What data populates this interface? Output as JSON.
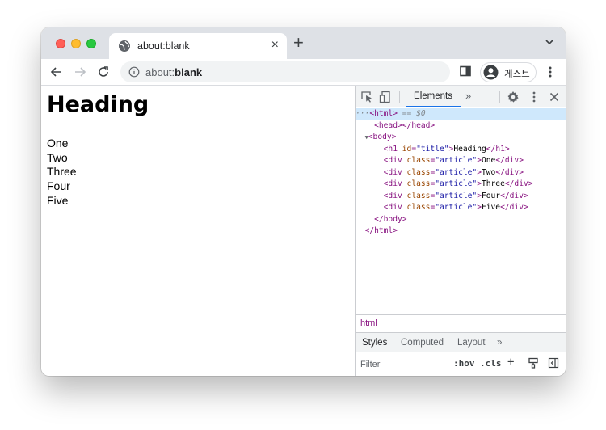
{
  "tab": {
    "title": "about:blank",
    "close": "×"
  },
  "newtab": "+",
  "omnibox": {
    "prefix": "about:",
    "bold": "blank"
  },
  "profile": {
    "label": "게스트"
  },
  "page": {
    "heading": "Heading",
    "articles": [
      "One",
      "Two",
      "Three",
      "Four",
      "Five"
    ]
  },
  "devtools": {
    "tab_elements": "Elements",
    "more_tabs": "»",
    "dom": {
      "html_open_prefix": "···",
      "html_open": "<html>",
      "selected_marker": " == $0",
      "head": "<head></head>",
      "body_arrow": "▼",
      "body_open": "<body>",
      "h1_open": "<h1 ",
      "h1_attr": "id",
      "h1_val": "\"title\"",
      "h1_text": "Heading",
      "h1_close": "</h1>",
      "div_open": "<div ",
      "div_attr": "class",
      "div_val": "\"article\"",
      "div_close": "</div>",
      "div_texts": [
        "One",
        "Two",
        "Three",
        "Four",
        "Five"
      ],
      "body_close": "</body>",
      "html_close": "</html>"
    },
    "breadcrumb": "html",
    "subtabs": [
      "Styles",
      "Computed",
      "Layout",
      "»"
    ],
    "filter_placeholder": "Filter",
    "hov": ":hov",
    "cls": ".cls",
    "plus": "+"
  }
}
